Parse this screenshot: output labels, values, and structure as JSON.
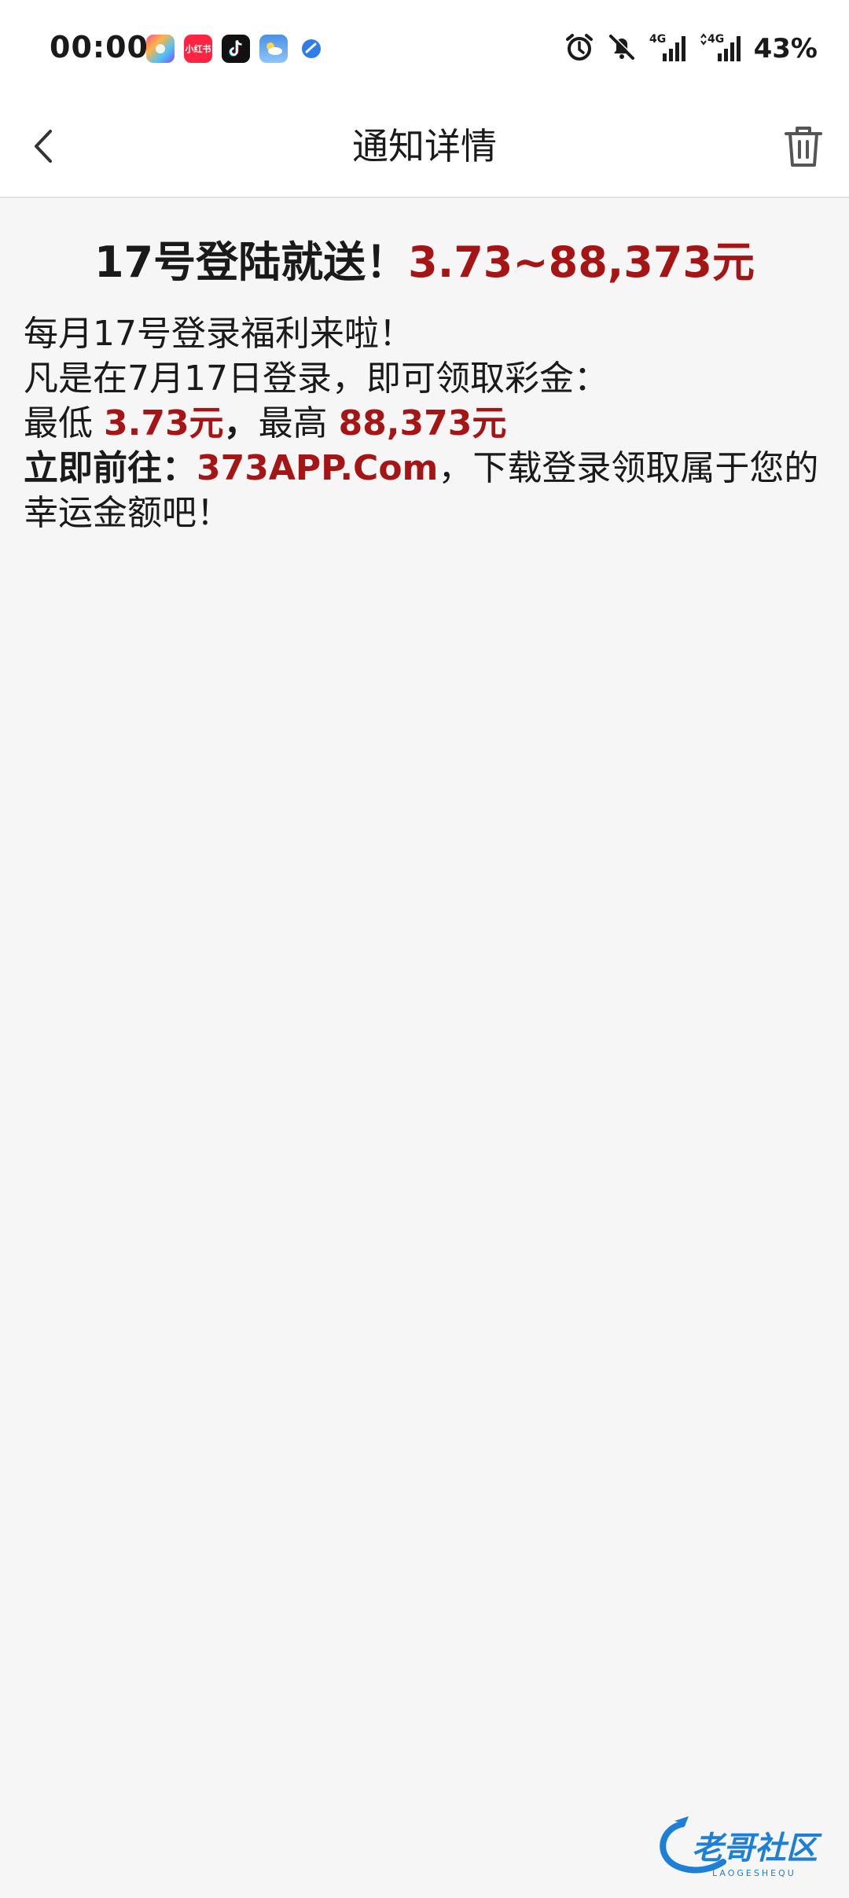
{
  "status_bar": {
    "time": "00:00",
    "battery": "43%",
    "icons": [
      "photos-app-icon",
      "xiaohongshu-app-icon",
      "tiktok-app-icon",
      "weather-app-icon",
      "blue-app-icon",
      "alarm-icon",
      "mute-bell-icon",
      "signal-4g-icon",
      "signal-4g-data-icon"
    ],
    "xhs_label": "小红书",
    "network_label": "4G"
  },
  "header": {
    "title": "通知详情",
    "back_icon": "chevron-left-icon",
    "delete_icon": "trash-icon"
  },
  "notice": {
    "title_prefix": "17号登陆就送！",
    "title_amount": "3.73~88,373元",
    "line1": "每月17号登录福利来啦！",
    "line2": "凡是在7月17日登录，即可领取彩金：",
    "line3_label1": "最低 ",
    "line3_min": "3.73元",
    "line3_sep": "，",
    "line3_label2": "最高 ",
    "line3_max": "88,373元",
    "line4_label": "立即前往：",
    "line4_link": "373APP.Com",
    "line4_rest": "，下载登录领取属于您的幸运金额吧！"
  },
  "watermark": {
    "text": "老哥社区",
    "subtext": "LAOGESHEQU"
  },
  "colors": {
    "accent_red": "#a61515",
    "background": "#f6f6f6",
    "bar": "#ffffff",
    "watermark_blue": "#1e7fd6"
  }
}
